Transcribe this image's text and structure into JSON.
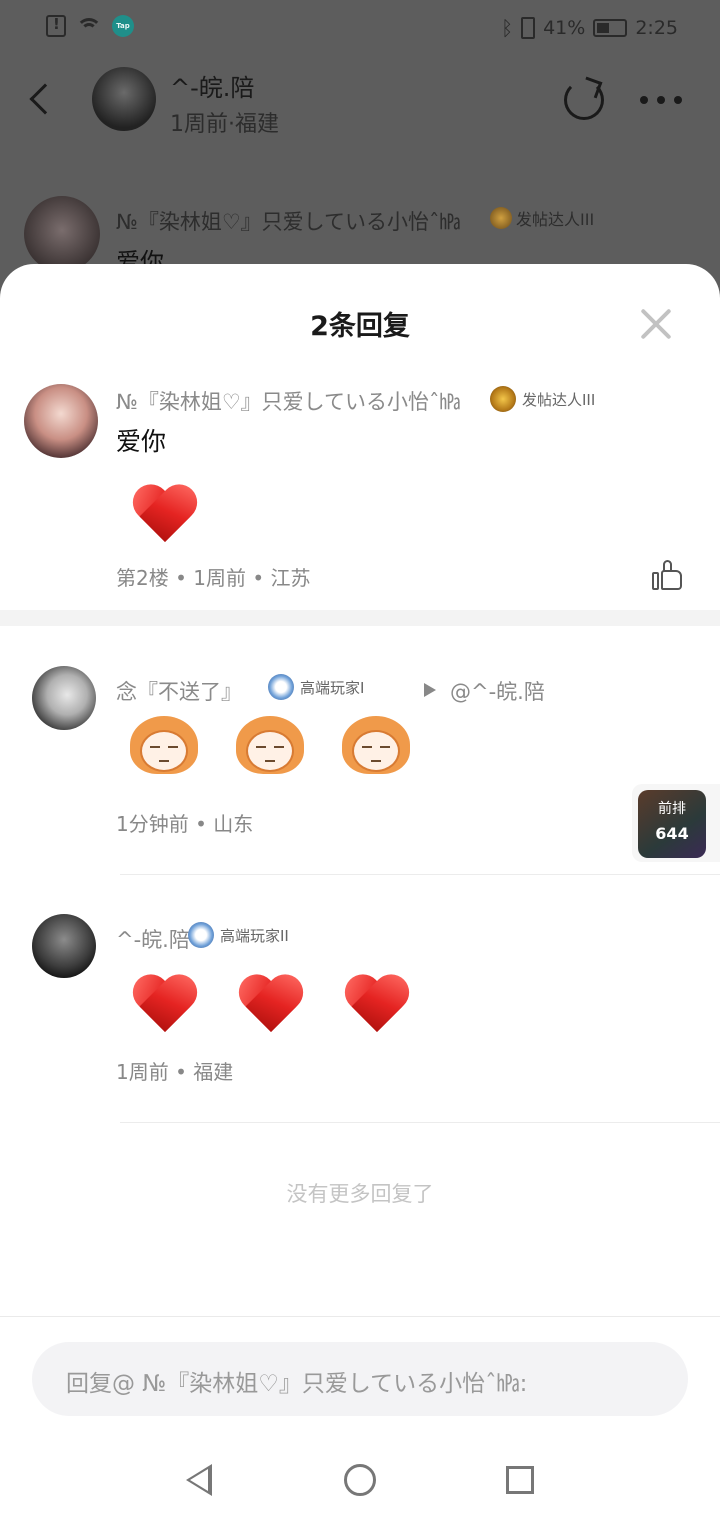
{
  "status_bar": {
    "battery_percent": "41%",
    "time": "2:25",
    "tap_badge": "Tap"
  },
  "header": {
    "author_name": "^-皖.陪",
    "author_meta": "1周前·福建"
  },
  "background_comment": {
    "name": "№『染林姐♡』只爱している小怡ˆ㍱",
    "badge": "发帖达人III",
    "text": "爱你"
  },
  "sheet": {
    "title": "2条回复"
  },
  "main_comment": {
    "name": "№『染林姐♡』只爱している小怡ˆ㍱",
    "badge": "发帖达人III",
    "text": "爱你",
    "meta": "第2楼 • 1周前 • 江苏",
    "hearts": 1
  },
  "replies": [
    {
      "name": "念『不送了』",
      "badge": "高端玩家I",
      "reply_to": "@^-皖.陪",
      "meta": "1分钟前 • 山东",
      "stickers": 3
    },
    {
      "name": "^-皖.陪",
      "badge": "高端玩家II",
      "meta": "1周前 • 福建",
      "hearts": 3
    }
  ],
  "floating_widget": {
    "label": "前排",
    "count": "644"
  },
  "no_more_text": "没有更多回复了",
  "input": {
    "placeholder": "回复@ №『染林姐♡』只爱している小怡ˆ㍱:"
  },
  "colors": {
    "overlay": "#5d5d5d",
    "heart": "#e52422",
    "sticker_hair": "#f09a4a"
  }
}
